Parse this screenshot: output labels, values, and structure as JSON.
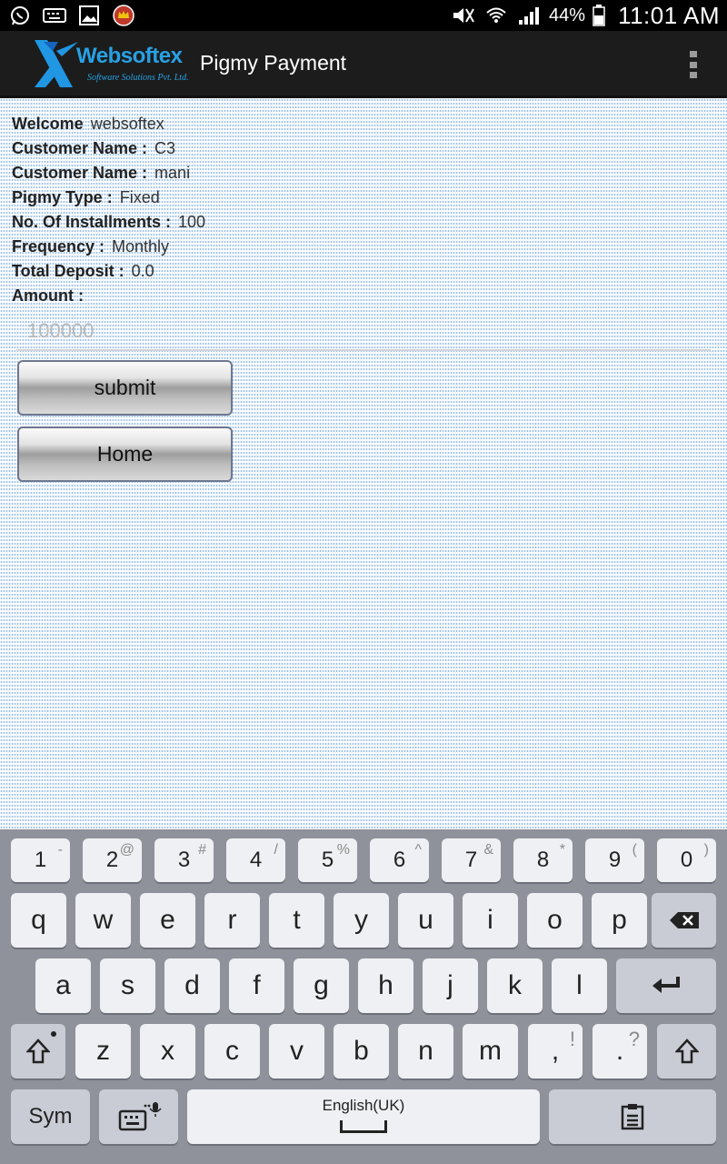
{
  "status_bar": {
    "battery_percent": "44%",
    "time": "11:01 AM"
  },
  "action_bar": {
    "logo": {
      "name": "Websoftex",
      "tagline": "Software Solutions Pvt. Ltd."
    },
    "title": "Pigmy Payment"
  },
  "details": [
    {
      "label": "Welcome",
      "value": "websoftex"
    },
    {
      "label": "Customer Name :",
      "value": "C3"
    },
    {
      "label": "Customer Name :",
      "value": "mani"
    },
    {
      "label": "Pigmy Type :",
      "value": "Fixed"
    },
    {
      "label": "No. Of Installments :",
      "value": "100"
    },
    {
      "label": "Frequency :",
      "value": "Monthly"
    },
    {
      "label": "Total Deposit :",
      "value": "0.0"
    },
    {
      "label": "Amount :",
      "value": ""
    }
  ],
  "amount_field": {
    "placeholder": "100000",
    "value": ""
  },
  "buttons": {
    "submit": "submit",
    "home": "Home"
  },
  "keyboard": {
    "number_row": [
      {
        "main": "1",
        "sup": "-"
      },
      {
        "main": "2",
        "sup": "@"
      },
      {
        "main": "3",
        "sup": "#"
      },
      {
        "main": "4",
        "sup": "/"
      },
      {
        "main": "5",
        "sup": "%"
      },
      {
        "main": "6",
        "sup": "^"
      },
      {
        "main": "7",
        "sup": "&"
      },
      {
        "main": "8",
        "sup": "*"
      },
      {
        "main": "9",
        "sup": "("
      },
      {
        "main": "0",
        "sup": ")"
      }
    ],
    "row1": [
      "q",
      "w",
      "e",
      "r",
      "t",
      "y",
      "u",
      "i",
      "o",
      "p"
    ],
    "row2": [
      "a",
      "s",
      "d",
      "f",
      "g",
      "h",
      "j",
      "k",
      "l"
    ],
    "row3": [
      "z",
      "x",
      "c",
      "v",
      "b",
      "n",
      "m"
    ],
    "comma": {
      "main": ",",
      "sup": "!"
    },
    "period": {
      "main": ".",
      "sup": "?"
    },
    "sym_label": "Sym",
    "space_label": "English(UK)"
  },
  "colors": {
    "accent": "#27a1e6",
    "action_bar": "#1c1c1c",
    "keyboard_bg": "#8f929b"
  }
}
